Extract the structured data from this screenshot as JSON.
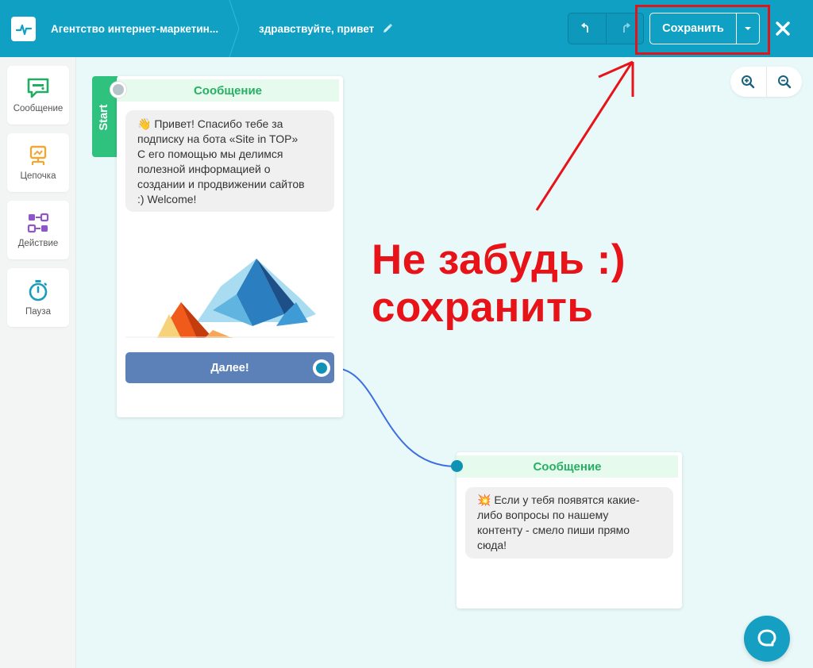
{
  "header": {
    "project_name": "Агентство интернет-маркетин...",
    "bot_name": "здравствуйте, привет",
    "save_label": "Сохранить"
  },
  "sidebar": {
    "items": [
      {
        "label": "Сообщение",
        "icon": "message-icon"
      },
      {
        "label": "Цепочка",
        "icon": "chain-icon"
      },
      {
        "label": "Действие",
        "icon": "action-icon"
      },
      {
        "label": "Пауза",
        "icon": "timer-icon"
      }
    ]
  },
  "canvas": {
    "start_label": "Start",
    "card1": {
      "header": "Сообщение",
      "text": "👋 Привет! Спасибо тебе за подписку на бота «Site in TOP» С его помощью мы делимся полезной информацией о создании и продвижении сайтов :) Welcome!",
      "lines": [
        "👋 Привет! Спасибо тебе за",
        "подписку на бота «Site in TOP»",
        "С его помощью мы делимся",
        "полезной информацией о",
        "создании и продвижении сайтов",
        ":) Welcome!"
      ],
      "button_label": "Далее!"
    },
    "card2": {
      "header": "Сообщение",
      "lines": [
        "💥 Если у тебя появятся какие-",
        "либо вопросы по нашему",
        "контенту - смело пиши прямо",
        "сюда!"
      ]
    }
  },
  "annotation": {
    "line1": "Не забудь :)",
    "line2": "сохранить"
  },
  "colors": {
    "header_bg": "#0fa0c4",
    "accent_green": "#27b063",
    "button_blue": "#5b81b8",
    "annotation_red": "#e81219"
  }
}
